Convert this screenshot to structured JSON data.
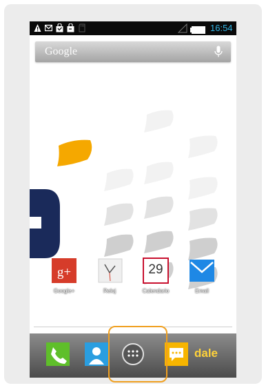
{
  "status_bar": {
    "time": "16:54",
    "icons": [
      "warning-icon",
      "mail-icon",
      "shopping-bag-icon",
      "shopping-bag-icon",
      "sd-card-icon",
      "signal-icon",
      "battery-icon"
    ],
    "clock_color": "#33b5e5"
  },
  "search": {
    "text": "Google",
    "icon": "mic-icon"
  },
  "apps": [
    {
      "label": "Google+",
      "icon": "google-plus-icon"
    },
    {
      "label": "Reloj",
      "icon": "clock-icon"
    },
    {
      "label": "Calendario",
      "icon": "calendar-icon",
      "day": "29"
    },
    {
      "label": "Email",
      "icon": "email-icon"
    }
  ],
  "dock": {
    "items": [
      "phone-icon",
      "contacts-icon",
      "app-drawer-icon",
      "messaging-icon"
    ],
    "brand": "dale",
    "brand_color": "#ffd23a"
  },
  "highlight_color": "#f0a020"
}
